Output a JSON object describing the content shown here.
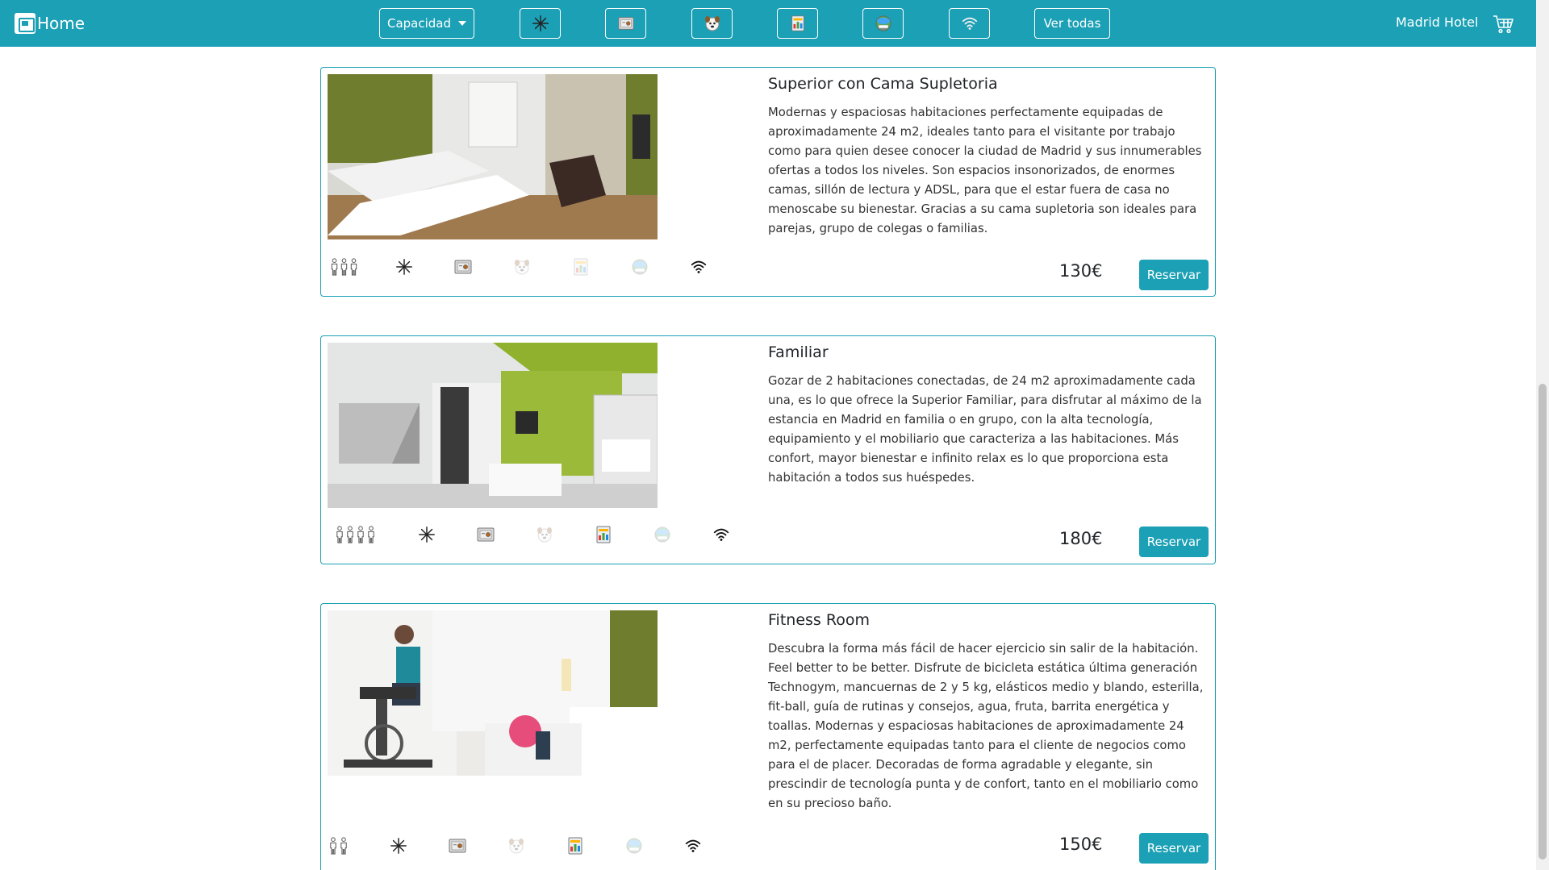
{
  "nav": {
    "brand": "Home",
    "capacity_label": "Capacidad",
    "filters": [
      {
        "icon": "snowflake-icon"
      },
      {
        "icon": "safe-icon"
      },
      {
        "icon": "pet-icon"
      },
      {
        "icon": "minibar-icon"
      },
      {
        "icon": "tv-icon"
      },
      {
        "icon": "wifi-icon"
      }
    ],
    "see_all": "Ver todas",
    "hotel_name": "Madrid Hotel"
  },
  "rooms": [
    {
      "title": "Superior con Cama Supletoria",
      "description": "Modernas y espaciosas habitaciones perfectamente equipadas de aproximadamente 24 m2, ideales tanto para el visitante por trabajo como para quien desee conocer la ciudad de Madrid y sus innumerables ofertas a todos los niveles. Son espacios insonorizados, de enormes camas, sillón de lectura y ADSL, para que el estar fuera de casa no menoscabe su bienestar. Gracias a su cama supletoria son ideales para parejas, grupo de colegas o familias.",
      "price": "130€",
      "button": "Reservar",
      "capacity": 3,
      "amenities": {
        "ac": true,
        "safe": true,
        "pets": false,
        "minibar": false,
        "tv": false,
        "wifi": true
      }
    },
    {
      "title": "Familiar",
      "description": "Gozar de 2 habitaciones conectadas, de 24 m2 aproximadamente cada una, es lo que ofrece la Superior Familiar, para disfrutar al máximo de la estancia en Madrid en familia o en grupo, con la alta tecnología, equipamiento y el mobiliario que caracteriza a las habitaciones. Más confort, mayor bienestar e infinito relax es lo que proporciona esta habitación a todos sus huéspedes.",
      "price": "180€",
      "button": "Reservar",
      "capacity": 4,
      "amenities": {
        "ac": true,
        "safe": true,
        "pets": false,
        "minibar": true,
        "tv": false,
        "wifi": true
      }
    },
    {
      "title": "Fitness Room",
      "description": "Descubra la forma más fácil de hacer ejercicio sin salir de la habitación. Feel better to be better. Disfrute de bicicleta estática última generación Technogym, mancuernas de 2 y 5 kg, elásticos medio y blando, esterilla, fit-ball, guía de rutinas y consejos, agua, fruta, barrita energética y toallas. Modernas y espaciosas habitaciones de aproximadamente 24 m2, perfectamente equipadas tanto para el cliente de negocios como para el de placer. Decoradas de forma agradable y elegante, sin prescindir de tecnología punta y de confort, tanto en el mobiliario como en su precioso baño.",
      "price": "150€",
      "button": "Reservar",
      "capacity": 2,
      "amenities": {
        "ac": true,
        "safe": true,
        "pets": false,
        "minibar": true,
        "tv": false,
        "wifi": true
      }
    }
  ],
  "colors": {
    "primary": "#1ba0b5",
    "border": "#1ba0b5"
  }
}
